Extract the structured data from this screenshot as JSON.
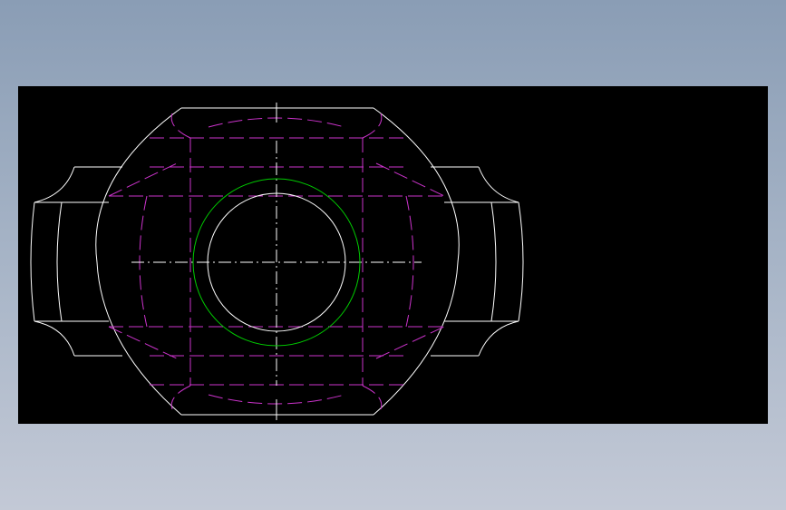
{
  "drawing": {
    "background_color": "#000000",
    "colors": {
      "outline": "#ffffff",
      "hidden_lines": "#cc33cc",
      "bore_circle": "#00cc00",
      "centerlines": "#ffffff"
    },
    "view": "front-view",
    "features": [
      "outer-body-outline",
      "left-flange",
      "right-flange",
      "bore-circle",
      "inner-bore",
      "hidden-edges",
      "horizontal-centerline",
      "vertical-centerline"
    ]
  }
}
